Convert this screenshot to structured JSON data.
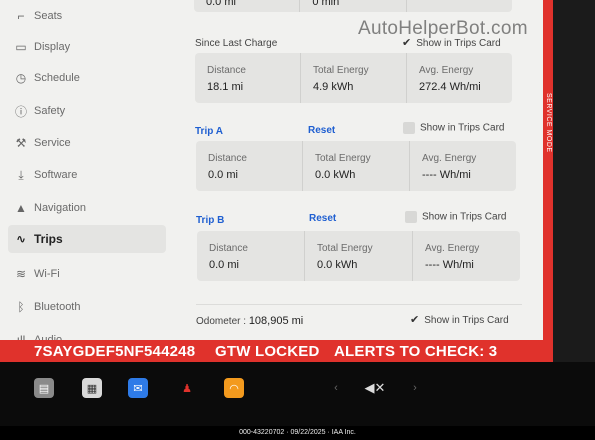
{
  "sidebar": {
    "items": [
      {
        "label": "Seats",
        "icon": "seat-icon"
      },
      {
        "label": "Display",
        "icon": "display-icon"
      },
      {
        "label": "Schedule",
        "icon": "clock-icon"
      },
      {
        "label": "Safety",
        "icon": "info-icon"
      },
      {
        "label": "Service",
        "icon": "wrench-icon"
      },
      {
        "label": "Software",
        "icon": "download-icon"
      },
      {
        "label": "Navigation",
        "icon": "navigation-arrow-icon"
      },
      {
        "label": "Trips",
        "icon": "trips-icon",
        "active": true
      },
      {
        "label": "Wi-Fi",
        "icon": "wifi-icon"
      },
      {
        "label": "Bluetooth",
        "icon": "bluetooth-icon"
      },
      {
        "label": "Audio",
        "icon": "audio-icon"
      }
    ]
  },
  "top_partial": {
    "distance_value": "0.0 mi",
    "time_value": "0 min"
  },
  "since_last_charge": {
    "title": "Since Last Charge",
    "show_label": "Show in Trips Card",
    "checked": true,
    "distance_title": "Distance",
    "distance_value": "18.1 mi",
    "energy_title": "Total Energy",
    "energy_value": "4.9 kWh",
    "avg_title": "Avg. Energy",
    "avg_value": "272.4  Wh/mi"
  },
  "trip_a": {
    "title": "Trip A",
    "reset_label": "Reset",
    "show_label": "Show in Trips Card",
    "checked": false,
    "distance_title": "Distance",
    "distance_value": "0.0 mi",
    "energy_title": "Total Energy",
    "energy_value": "0.0 kWh",
    "avg_title": "Avg. Energy",
    "avg_value": "----  Wh/mi"
  },
  "trip_b": {
    "title": "Trip B",
    "reset_label": "Reset",
    "show_label": "Show in Trips Card",
    "checked": false,
    "distance_title": "Distance",
    "distance_value": "0.0 mi",
    "energy_title": "Total Energy",
    "energy_value": "0.0 kWh",
    "avg_title": "Avg. Energy",
    "avg_value": "----  Wh/mi"
  },
  "odometer": {
    "label": "Odometer",
    "separator": ":",
    "value": "108,905  mi",
    "show_label": "Show in Trips Card",
    "checked": true
  },
  "service_mode": {
    "vertical_label": "SERVICE MODE",
    "vin": "7SAYGDEF5NF544248",
    "gtw": "GTW LOCKED",
    "alerts": "ALERTS TO CHECK: 3",
    "color": "#e0322c"
  },
  "dock": {
    "icons": [
      "notes-icon",
      "calendar-icon",
      "messages-icon",
      "joystick-icon",
      "audible-icon",
      "chevron-left-icon",
      "mute-icon",
      "chevron-right-icon"
    ],
    "mute_symbol": "🔇✕"
  },
  "watermark": "AutoHelperBot.com",
  "footer": "000-43220702 · 09/22/2025 · IAA Inc."
}
